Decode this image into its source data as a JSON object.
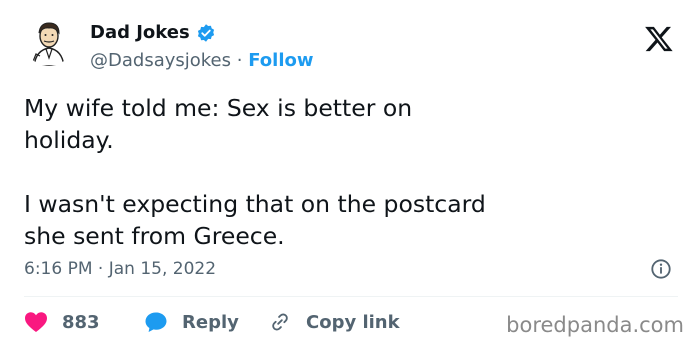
{
  "author": {
    "name": "Dad Jokes",
    "handle": "@Dadsaysjokes",
    "separator": "·",
    "follow_label": "Follow"
  },
  "tweet": {
    "paragraph1": "My wife told me: Sex is better on\nholiday.",
    "paragraph2": "I wasn't expecting that on the postcard\nshe sent from Greece."
  },
  "meta": {
    "timestamp": "6:16 PM · Jan 15, 2022"
  },
  "actions": {
    "like_count": "883",
    "reply_label": "Reply",
    "copy_label": "Copy link"
  },
  "watermark": "boredpanda.com",
  "icons": {
    "verified": "verified-badge-icon",
    "x_logo": "x-logo-icon",
    "info": "info-icon",
    "like": "heart-icon",
    "reply": "speech-bubble-icon",
    "copy": "link-icon"
  },
  "colors": {
    "text": "#0f1419",
    "muted": "#536471",
    "accent": "#1d9bf0",
    "like": "#f91880"
  }
}
